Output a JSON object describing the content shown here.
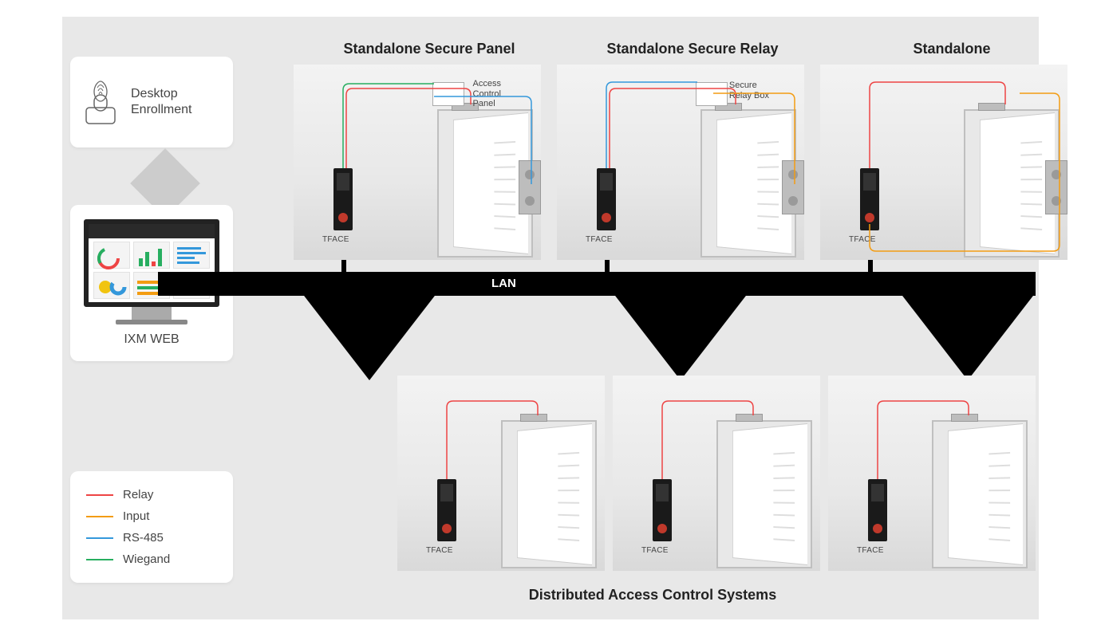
{
  "sidebar": {
    "enrollment_label": "Desktop\nEnrollment",
    "ixm_label": "IXM WEB"
  },
  "legend": [
    {
      "name": "Relay",
      "color": "#e44"
    },
    {
      "name": "Input",
      "color": "#f39c12"
    },
    {
      "name": "RS-485",
      "color": "#3498db"
    },
    {
      "name": "Wiegand",
      "color": "#27ae60"
    }
  ],
  "headers": {
    "h1": "Standalone Secure Panel",
    "h2": "Standalone Secure Relay",
    "h3": "Standalone"
  },
  "center_label": "LAN",
  "bottom_title": "Distributed Access Control Systems",
  "panel_labels": {
    "acp": "Access\nControl\nPanel",
    "srb": "Secure\nRelay Box"
  },
  "device_label": "TFACE",
  "colors": {
    "relay": "#e44",
    "input": "#f39c12",
    "rs485": "#3498db",
    "wiegand": "#27ae60",
    "black": "#000"
  }
}
